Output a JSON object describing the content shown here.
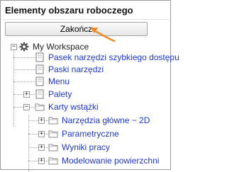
{
  "panel": {
    "title": "Elementy obszaru roboczego",
    "finish_button": "Zakończ"
  },
  "tree": {
    "root": {
      "label": "My Workspace",
      "icon": "gear-icon"
    },
    "items": [
      {
        "label": "Pasek narzędzi szybkiego dostępu",
        "icon": "document-icon"
      },
      {
        "label": "Paski narzędzi",
        "icon": "document-icon"
      },
      {
        "label": "Menu",
        "icon": "document-icon"
      },
      {
        "label": "Palety",
        "icon": "document-icon"
      },
      {
        "label": "Karty wstążki",
        "icon": "folder-icon"
      }
    ],
    "ribbon_tabs": [
      {
        "label": "Narzędzia główne − 2D",
        "icon": "folder-icon"
      },
      {
        "label": "Parametryczne",
        "icon": "folder-icon"
      },
      {
        "label": "Wyniki pracy",
        "icon": "folder-icon"
      },
      {
        "label": "Modelowanie powierzchni",
        "icon": "folder-icon"
      }
    ]
  },
  "colors": {
    "link_text": "#1d38d6",
    "annotation_arrow": "#f08a24"
  }
}
